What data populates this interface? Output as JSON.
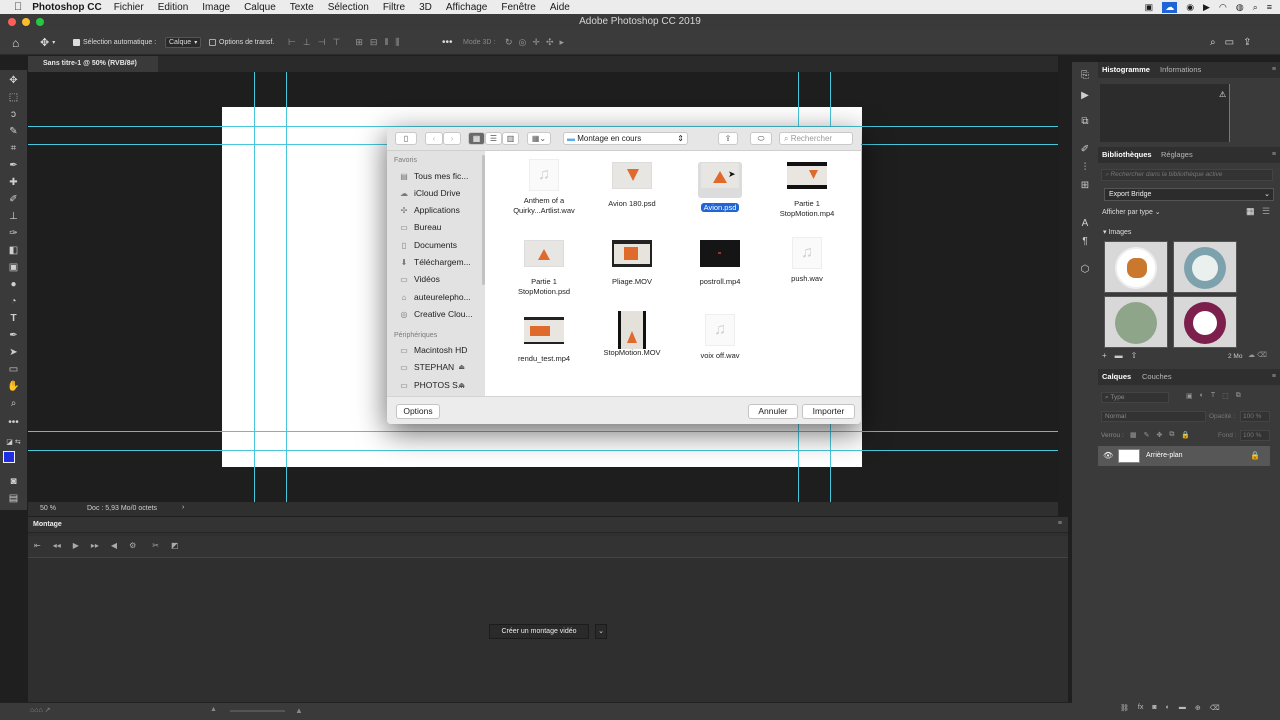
{
  "menubar": {
    "app_name": "Photoshop CC",
    "items": [
      "Fichier",
      "Edition",
      "Image",
      "Calque",
      "Texte",
      "Sélection",
      "Filtre",
      "3D",
      "Affichage",
      "Fenêtre",
      "Aide"
    ]
  },
  "window": {
    "title": "Adobe Photoshop CC 2019"
  },
  "options_bar": {
    "auto_select_label": "Sélection automatique :",
    "auto_select_value": "Calque",
    "transform_label": "Options de transf.",
    "mode3d_label": "Mode 3D :"
  },
  "document": {
    "tab_label": "Sans titre-1 @ 50% (RVB/8#)"
  },
  "status": {
    "zoom": "50 %",
    "doc_info": "Doc : 5,93 Mo/0 octets"
  },
  "dialog": {
    "location": "Montage en cours",
    "search_placeholder": "Rechercher",
    "sidebar": {
      "favorites_header": "Favoris",
      "favorites": [
        {
          "label": "Tous mes fic...",
          "icon": "all-files-icon"
        },
        {
          "label": "iCloud Drive",
          "icon": "cloud-icon"
        },
        {
          "label": "Applications",
          "icon": "applications-icon"
        },
        {
          "label": "Bureau",
          "icon": "folder-icon"
        },
        {
          "label": "Documents",
          "icon": "documents-icon"
        },
        {
          "label": "Téléchargem...",
          "icon": "download-icon"
        },
        {
          "label": "Vidéos",
          "icon": "folder-icon"
        },
        {
          "label": "auteurelepho...",
          "icon": "home-icon"
        },
        {
          "label": "Creative Clou...",
          "icon": "creative-cloud-icon"
        }
      ],
      "devices_header": "Périphériques",
      "devices": [
        {
          "label": "Macintosh HD"
        },
        {
          "label": "STEPHAN"
        },
        {
          "label": "PHOTOS S..."
        }
      ]
    },
    "files": [
      {
        "name1": "Anthem of a",
        "name2": "Quirky...Artlist.wav",
        "kind": "audio"
      },
      {
        "name1": "Avion 180.psd",
        "name2": "",
        "kind": "psd-flip"
      },
      {
        "name1": "Avion.psd",
        "name2": "",
        "kind": "psd",
        "selected": true
      },
      {
        "name1": "Partie 1",
        "name2": "StopMotion.mp4",
        "kind": "video-light"
      },
      {
        "name1": "Partie 1",
        "name2": "StopMotion.psd",
        "kind": "psd"
      },
      {
        "name1": "Pliage.MOV",
        "name2": "",
        "kind": "video-hands"
      },
      {
        "name1": "postroll.mp4",
        "name2": "",
        "kind": "video-dark"
      },
      {
        "name1": "push.wav",
        "name2": "",
        "kind": "audio"
      },
      {
        "name1": "rendu_test.mp4",
        "name2": "",
        "kind": "video-hands"
      },
      {
        "name1": "StopMotion.MOV",
        "name2": "",
        "kind": "video-tall"
      },
      {
        "name1": "voix off.wav",
        "name2": "",
        "kind": "audio"
      }
    ],
    "options_button": "Options",
    "cancel_button": "Annuler",
    "import_button": "Importer"
  },
  "right_panels": {
    "top_tabs": [
      "Histogramme",
      "Informations"
    ],
    "lib_tabs": [
      "Bibliothèques",
      "Réglages"
    ],
    "lib_search_placeholder": "Rechercher dans la bibliothèque active",
    "library_name": "Export Bridge",
    "display_by": "Afficher par type",
    "images_header": "Images",
    "lib_size": "2 Mo",
    "layer_tabs": [
      "Calques",
      "Couches"
    ],
    "layer_filter": "Type",
    "blend_mode": "Normal",
    "opacity_label": "Opacité :",
    "opacity_value": "100 %",
    "lock_label": "Verrou :",
    "fill_label": "Fond :",
    "fill_value": "100 %",
    "layer_name": "Arrière-plan"
  },
  "timeline": {
    "tab": "Montage",
    "create_button": "Créer un montage vidéo"
  },
  "colors": {
    "accent": "#1f65d6",
    "guide": "#47c6dc",
    "foreground": "#1f2ee0"
  }
}
